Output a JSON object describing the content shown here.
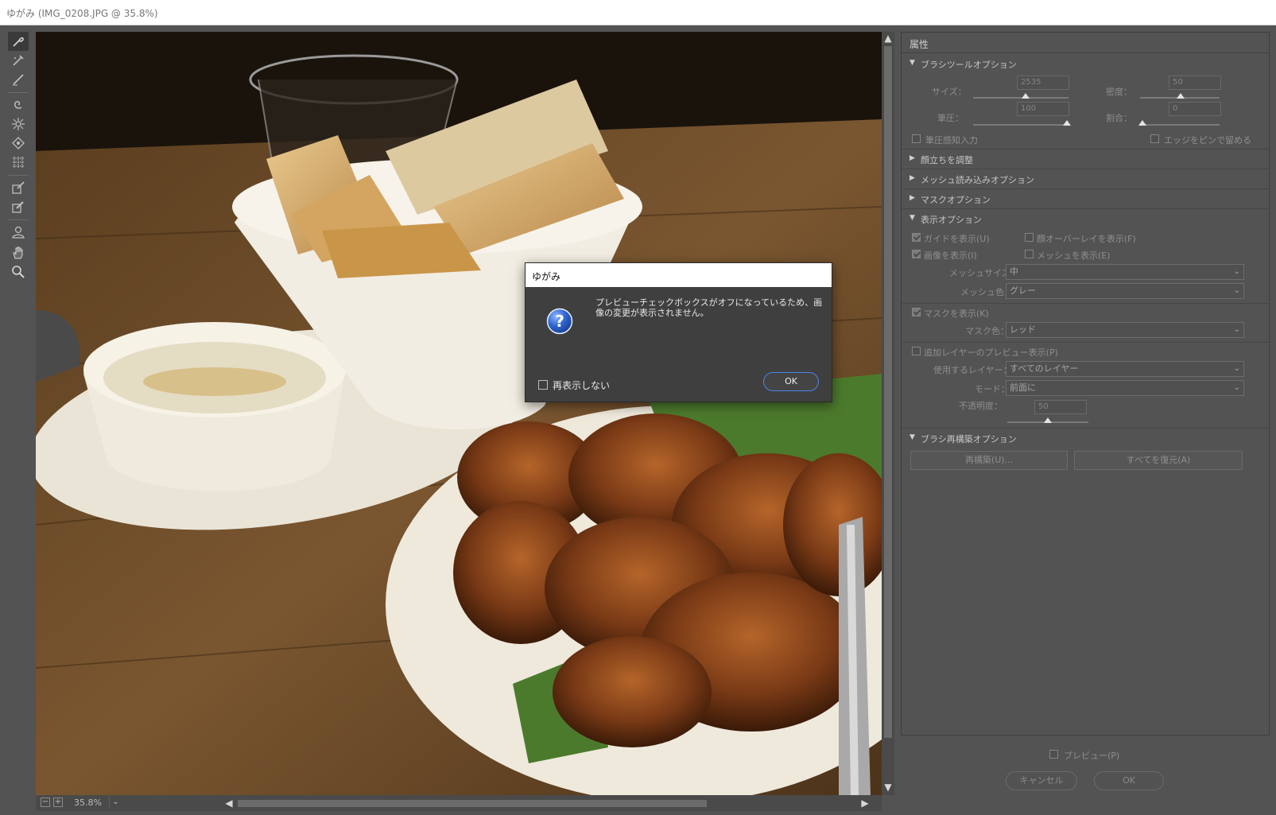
{
  "window": {
    "title": "ゆがみ (IMG_0208.JPG @ 35.8%)"
  },
  "toolbar": {
    "tools": [
      {
        "name": "forward-warp-tool",
        "active": true
      },
      {
        "name": "reconstruct-tool"
      },
      {
        "name": "smooth-tool"
      },
      {
        "name": "twirl-tool"
      },
      {
        "name": "pucker-tool"
      },
      {
        "name": "bloat-tool"
      },
      {
        "name": "push-left-tool"
      },
      {
        "name": "freeze-mask-tool"
      },
      {
        "name": "thaw-mask-tool"
      },
      {
        "name": "face-tool"
      },
      {
        "name": "hand-tool"
      },
      {
        "name": "zoom-tool"
      }
    ]
  },
  "status": {
    "zoom_value": "35.8%",
    "minus": "−",
    "plus": "+",
    "dropdown": "⌄"
  },
  "panel": {
    "title": "属性",
    "brush_section": "ブラシツールオプション",
    "size_label": "サイズ：",
    "size_value": "2535",
    "density_label": "密度：",
    "density_value": "50",
    "pressure_label": "筆圧：",
    "pressure_value": "100",
    "rate_label": "割合：",
    "rate_value": "0",
    "stylus_label": "筆圧感知入力",
    "pin_edges_label": "エッジをピンで留める",
    "face_section": "顔立ちを調整",
    "mesh_load_section": "メッシュ読み込みオプション",
    "mask_section": "マスクオプション",
    "view_section": "表示オプション",
    "show_guides": "ガイドを表示(U)",
    "show_face_overlay": "顔オーバーレイを表示(F)",
    "show_image": "画像を表示(I)",
    "show_mesh": "メッシュを表示(E)",
    "mesh_size_label": "メッシュサイズ：",
    "mesh_size_value": "中",
    "mesh_color_label": "メッシュ色：",
    "mesh_color_value": "グレー",
    "show_mask": "マスクを表示(K)",
    "mask_color_label": "マスク色：",
    "mask_color_value": "レッド",
    "show_backdrop": "追加レイヤーのプレビュー表示(P)",
    "use_layer_label": "使用するレイヤー：",
    "use_layer_value": "すべてのレイヤー",
    "mode_label": "モード：",
    "mode_value": "前面に",
    "opacity_label": "不透明度：",
    "opacity_value": "50",
    "reconstruct_section": "ブラシ再構築オプション",
    "reconstruct_button": "再構築(U)...",
    "restore_all_button": "すべてを復元(A)"
  },
  "footer": {
    "preview_label": "プレビュー(P)",
    "cancel_label": "キャンセル",
    "ok_label": "OK"
  },
  "dialog": {
    "title": "ゆがみ",
    "message": "プレビューチェックボックスがオフになっているため、画像の変更が表示されません。",
    "dont_show_label": "再表示しない",
    "ok_label": "OK"
  },
  "colors": {
    "ui_bg": "#535353",
    "dialog_bg": "#3f3f3f",
    "ok_border": "#4a86e8",
    "help_icon": "#2455b8"
  }
}
